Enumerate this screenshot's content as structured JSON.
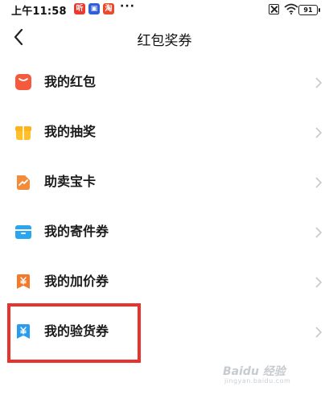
{
  "status_bar": {
    "time": "上午11:58",
    "dots": "···",
    "battery": "91"
  },
  "nav": {
    "title": "红包奖券"
  },
  "menu": {
    "items": [
      {
        "label": "我的红包",
        "icon": "red-packet-icon",
        "color": "#f55a3c"
      },
      {
        "label": "我的抽奖",
        "icon": "gift-box-icon",
        "color": "#ffc02e"
      },
      {
        "label": "助卖宝卡",
        "icon": "trend-card-icon",
        "color": "#f28b3a"
      },
      {
        "label": "我的寄件券",
        "icon": "package-icon",
        "color": "#2aa6f0"
      },
      {
        "label": "我的加价券",
        "icon": "yuan-coupon-icon",
        "color": "#f5792a"
      },
      {
        "label": "我的验货券",
        "icon": "yuan-shield-icon",
        "color": "#2a9cf0"
      }
    ]
  },
  "watermark": {
    "text": "Baidu 经验",
    "sub": "jingyan.baidu.com"
  },
  "highlight_color": "#e8322e"
}
